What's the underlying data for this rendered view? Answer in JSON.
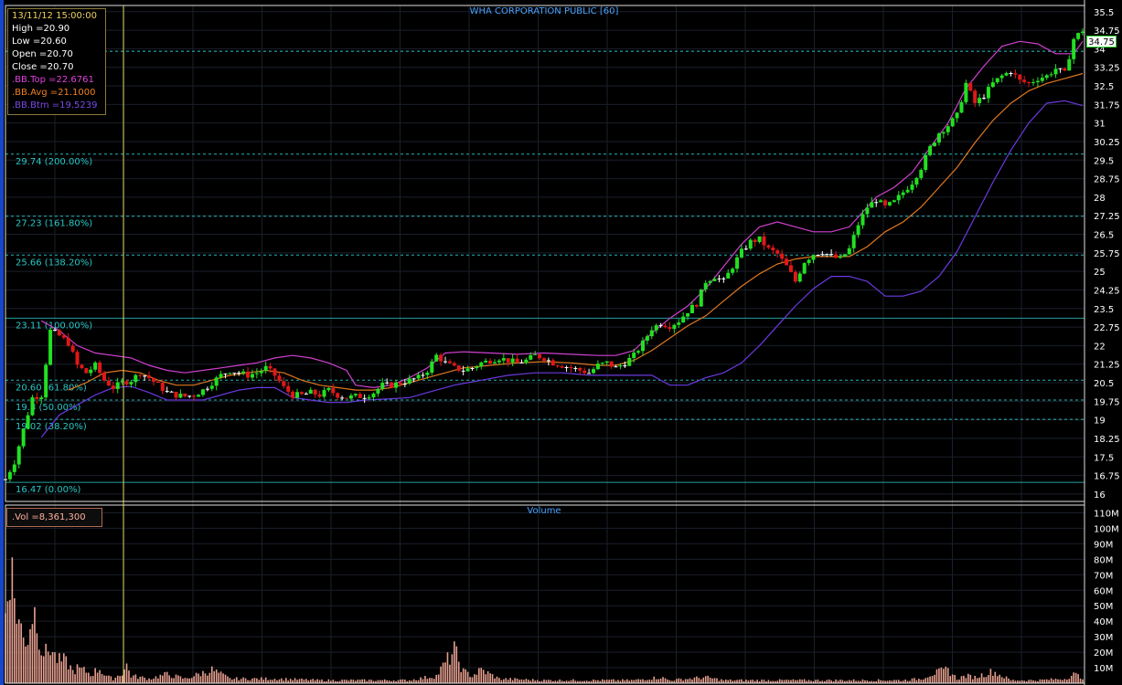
{
  "chart_data": {
    "type": "candlestick",
    "title": "WHA CORPORATION PUBLIC [60]",
    "volume_title": "Volume",
    "info": {
      "datetime": "13/11/12 15:00:00",
      "high": "High  =20.90",
      "low": "Low   =20.60",
      "open": "Open  =20.70",
      "close": "Close =20.70",
      "bb_top": ".BB.Top   =22.6761",
      "bb_avg": ".BB.Avg   =21.1000",
      "bb_btm": ".BB.Btm   =19.5239"
    },
    "volume_label": ".Vol   =8,361,300",
    "last_price": "34.75",
    "price_axis": {
      "ymin": 15.7,
      "ymax": 35.75,
      "ticks": [
        "35.5",
        "34.75",
        "34",
        "33.25",
        "32.5",
        "31.75",
        "31",
        "30.25",
        "29.5",
        "28.75",
        "28",
        "27.25",
        "26.5",
        "25.75",
        "25",
        "24.25",
        "23.5",
        "22.75",
        "22",
        "21.25",
        "20.5",
        "19.75",
        "19",
        "18.25",
        "17.5",
        "16.75",
        "16"
      ]
    },
    "volume_axis": {
      "ymax": 115000000,
      "ticks": [
        "110M",
        "100M",
        "90M",
        "80M",
        "70M",
        "60M",
        "50M",
        "40M",
        "30M",
        "20M",
        "10M"
      ]
    },
    "fibonacci": [
      {
        "label": "29.74 (200.00%)",
        "value": 29.74
      },
      {
        "label": "27.23 (161.80%)",
        "value": 27.23
      },
      {
        "label": "25.66 (138.20%)",
        "value": 25.66
      },
      {
        "label": "23.11 (100.00%)",
        "value": 23.11
      },
      {
        "label": "20.60 (61.80%)",
        "value": 20.6
      },
      {
        "label": "19.8 (50.00%)",
        "value": 19.8
      },
      {
        "label": "19.02 (38.20%)",
        "value": 19.02
      },
      {
        "label": "16.47 (0.00%)",
        "value": 16.47
      }
    ],
    "reference_line": 33.9,
    "colors": {
      "up": "#22e022",
      "down": "#e01818",
      "bb_top": "#d040d0",
      "bb_avg": "#e07820",
      "bb_btm": "#6a3ae0",
      "fib": "#28c8c8",
      "grid": "#1a1f2a",
      "axis_text": "#ffffff",
      "volume": "#e8a090",
      "cursor": "#d8d060"
    },
    "close_path": [
      [
        0,
        16.6
      ],
      [
        2,
        17.3
      ],
      [
        4,
        18.6
      ],
      [
        6,
        19.9
      ],
      [
        8,
        20.0
      ],
      [
        10,
        22.6
      ],
      [
        12,
        22.4
      ],
      [
        14,
        22.1
      ],
      [
        16,
        21.2
      ],
      [
        18,
        20.9
      ],
      [
        20,
        21.2
      ],
      [
        22,
        20.6
      ],
      [
        24,
        20.3
      ],
      [
        26,
        20.5
      ],
      [
        28,
        20.6
      ],
      [
        30,
        20.9
      ],
      [
        32,
        20.7
      ],
      [
        34,
        20.4
      ],
      [
        36,
        20.1
      ],
      [
        38,
        20.0
      ],
      [
        40,
        19.95
      ],
      [
        42,
        20.0
      ],
      [
        44,
        20.2
      ],
      [
        46,
        20.5
      ],
      [
        48,
        20.8
      ],
      [
        50,
        21.0
      ],
      [
        52,
        20.9
      ],
      [
        54,
        20.8
      ],
      [
        56,
        20.9
      ],
      [
        58,
        21.1
      ],
      [
        60,
        20.8
      ],
      [
        62,
        20.3
      ],
      [
        64,
        20.0
      ],
      [
        66,
        20.0
      ],
      [
        68,
        20.1
      ],
      [
        70,
        20.0
      ],
      [
        72,
        20.2
      ],
      [
        74,
        20.0
      ],
      [
        76,
        19.9
      ],
      [
        78,
        19.95
      ],
      [
        80,
        19.95
      ],
      [
        82,
        20.1
      ],
      [
        84,
        20.4
      ],
      [
        86,
        20.4
      ],
      [
        88,
        20.5
      ],
      [
        90,
        20.6
      ],
      [
        92,
        20.7
      ],
      [
        94,
        21.0
      ],
      [
        96,
        21.6
      ],
      [
        98,
        21.3
      ],
      [
        100,
        21.1
      ],
      [
        102,
        21.0
      ],
      [
        104,
        21.1
      ],
      [
        106,
        21.3
      ],
      [
        108,
        21.4
      ],
      [
        110,
        21.5
      ],
      [
        112,
        21.4
      ],
      [
        114,
        21.3
      ],
      [
        116,
        21.4
      ],
      [
        118,
        21.6
      ],
      [
        120,
        21.5
      ],
      [
        122,
        21.3
      ],
      [
        124,
        21.2
      ],
      [
        126,
        21.1
      ],
      [
        128,
        21.0
      ],
      [
        130,
        20.9
      ],
      [
        132,
        21.2
      ],
      [
        134,
        21.3
      ],
      [
        136,
        21.1
      ],
      [
        138,
        21.3
      ],
      [
        140,
        21.6
      ],
      [
        142,
        22.1
      ],
      [
        144,
        22.7
      ],
      [
        146,
        22.9
      ],
      [
        148,
        22.8
      ],
      [
        150,
        23.0
      ],
      [
        152,
        23.4
      ],
      [
        154,
        23.7
      ],
      [
        156,
        24.6
      ],
      [
        158,
        24.8
      ],
      [
        160,
        24.6
      ],
      [
        162,
        25.2
      ],
      [
        164,
        25.8
      ],
      [
        166,
        26.2
      ],
      [
        168,
        26.3
      ],
      [
        170,
        25.9
      ],
      [
        172,
        25.7
      ],
      [
        174,
        25.2
      ],
      [
        176,
        24.6
      ],
      [
        178,
        25.4
      ],
      [
        180,
        25.7
      ],
      [
        182,
        25.8
      ],
      [
        184,
        25.6
      ],
      [
        186,
        25.5
      ],
      [
        188,
        25.9
      ],
      [
        190,
        26.9
      ],
      [
        192,
        27.6
      ],
      [
        194,
        27.9
      ],
      [
        196,
        27.6
      ],
      [
        198,
        27.8
      ],
      [
        200,
        28.2
      ],
      [
        202,
        28.6
      ],
      [
        204,
        29.2
      ],
      [
        206,
        30.0
      ],
      [
        208,
        30.6
      ],
      [
        210,
        30.9
      ],
      [
        212,
        31.3
      ],
      [
        214,
        32.6
      ],
      [
        216,
        31.8
      ],
      [
        218,
        32.1
      ],
      [
        220,
        32.6
      ],
      [
        222,
        32.9
      ],
      [
        224,
        33.1
      ],
      [
        226,
        32.7
      ],
      [
        228,
        32.6
      ],
      [
        230,
        32.8
      ],
      [
        232,
        32.9
      ],
      [
        234,
        33.2
      ],
      [
        236,
        33.0
      ],
      [
        238,
        34.4
      ],
      [
        240,
        34.75
      ]
    ],
    "bb_top_path": [
      [
        8,
        23.0
      ],
      [
        12,
        22.6
      ],
      [
        16,
        22.0
      ],
      [
        20,
        21.7
      ],
      [
        24,
        21.6
      ],
      [
        28,
        21.5
      ],
      [
        32,
        21.2
      ],
      [
        36,
        21.0
      ],
      [
        40,
        20.9
      ],
      [
        44,
        21.0
      ],
      [
        48,
        21.1
      ],
      [
        52,
        21.2
      ],
      [
        56,
        21.3
      ],
      [
        60,
        21.5
      ],
      [
        64,
        21.6
      ],
      [
        68,
        21.5
      ],
      [
        72,
        21.3
      ],
      [
        76,
        21.0
      ],
      [
        78,
        20.4
      ],
      [
        82,
        20.3
      ],
      [
        86,
        20.4
      ],
      [
        90,
        20.7
      ],
      [
        94,
        21.1
      ],
      [
        98,
        21.7
      ],
      [
        102,
        21.75
      ],
      [
        108,
        21.7
      ],
      [
        114,
        21.65
      ],
      [
        120,
        21.7
      ],
      [
        126,
        21.65
      ],
      [
        132,
        21.6
      ],
      [
        136,
        21.6
      ],
      [
        140,
        21.8
      ],
      [
        144,
        22.5
      ],
      [
        148,
        23.1
      ],
      [
        152,
        23.6
      ],
      [
        156,
        24.3
      ],
      [
        160,
        25.2
      ],
      [
        164,
        26.1
      ],
      [
        168,
        26.8
      ],
      [
        172,
        27.0
      ],
      [
        176,
        26.8
      ],
      [
        180,
        26.6
      ],
      [
        184,
        26.6
      ],
      [
        188,
        26.8
      ],
      [
        190,
        27.2
      ],
      [
        194,
        28.0
      ],
      [
        198,
        28.4
      ],
      [
        202,
        29.0
      ],
      [
        206,
        30.0
      ],
      [
        210,
        31.0
      ],
      [
        214,
        32.4
      ],
      [
        218,
        33.3
      ],
      [
        222,
        34.1
      ],
      [
        226,
        34.3
      ],
      [
        230,
        34.2
      ],
      [
        234,
        33.8
      ],
      [
        238,
        33.8
      ],
      [
        240,
        34.3
      ]
    ],
    "bb_avg_path": [
      [
        14,
        20.2
      ],
      [
        18,
        20.5
      ],
      [
        22,
        20.9
      ],
      [
        26,
        21.0
      ],
      [
        30,
        20.9
      ],
      [
        34,
        20.6
      ],
      [
        38,
        20.4
      ],
      [
        42,
        20.4
      ],
      [
        46,
        20.6
      ],
      [
        50,
        20.8
      ],
      [
        54,
        20.9
      ],
      [
        58,
        21.0
      ],
      [
        62,
        20.9
      ],
      [
        66,
        20.6
      ],
      [
        70,
        20.4
      ],
      [
        74,
        20.3
      ],
      [
        78,
        20.2
      ],
      [
        82,
        20.2
      ],
      [
        86,
        20.3
      ],
      [
        90,
        20.5
      ],
      [
        94,
        20.7
      ],
      [
        98,
        20.9
      ],
      [
        102,
        21.1
      ],
      [
        108,
        21.2
      ],
      [
        114,
        21.3
      ],
      [
        120,
        21.35
      ],
      [
        126,
        21.3
      ],
      [
        132,
        21.2
      ],
      [
        136,
        21.2
      ],
      [
        140,
        21.4
      ],
      [
        144,
        21.8
      ],
      [
        148,
        22.3
      ],
      [
        152,
        22.8
      ],
      [
        156,
        23.2
      ],
      [
        160,
        23.8
      ],
      [
        164,
        24.4
      ],
      [
        168,
        24.9
      ],
      [
        172,
        25.3
      ],
      [
        176,
        25.5
      ],
      [
        180,
        25.6
      ],
      [
        184,
        25.6
      ],
      [
        188,
        25.6
      ],
      [
        192,
        26.0
      ],
      [
        196,
        26.6
      ],
      [
        200,
        27.0
      ],
      [
        204,
        27.6
      ],
      [
        208,
        28.4
      ],
      [
        212,
        29.2
      ],
      [
        216,
        30.2
      ],
      [
        220,
        31.1
      ],
      [
        224,
        31.8
      ],
      [
        228,
        32.3
      ],
      [
        232,
        32.6
      ],
      [
        236,
        32.8
      ],
      [
        240,
        33.0
      ]
    ],
    "bb_btm_path": [
      [
        8,
        18.3
      ],
      [
        12,
        19.2
      ],
      [
        16,
        19.6
      ],
      [
        20,
        20.0
      ],
      [
        24,
        20.3
      ],
      [
        28,
        20.35
      ],
      [
        32,
        20.1
      ],
      [
        36,
        19.8
      ],
      [
        40,
        19.8
      ],
      [
        44,
        19.8
      ],
      [
        48,
        20.0
      ],
      [
        52,
        20.2
      ],
      [
        56,
        20.3
      ],
      [
        60,
        20.3
      ],
      [
        64,
        19.9
      ],
      [
        68,
        19.8
      ],
      [
        72,
        19.7
      ],
      [
        76,
        19.7
      ],
      [
        80,
        19.8
      ],
      [
        86,
        19.85
      ],
      [
        90,
        19.9
      ],
      [
        94,
        20.1
      ],
      [
        100,
        20.4
      ],
      [
        106,
        20.6
      ],
      [
        112,
        20.8
      ],
      [
        118,
        20.9
      ],
      [
        124,
        20.9
      ],
      [
        130,
        20.8
      ],
      [
        136,
        20.8
      ],
      [
        140,
        20.8
      ],
      [
        144,
        20.8
      ],
      [
        148,
        20.4
      ],
      [
        152,
        20.4
      ],
      [
        156,
        20.7
      ],
      [
        160,
        20.9
      ],
      [
        164,
        21.3
      ],
      [
        168,
        22.0
      ],
      [
        172,
        22.8
      ],
      [
        176,
        23.6
      ],
      [
        180,
        24.3
      ],
      [
        184,
        24.8
      ],
      [
        188,
        24.8
      ],
      [
        192,
        24.6
      ],
      [
        196,
        24.0
      ],
      [
        200,
        24.0
      ],
      [
        204,
        24.2
      ],
      [
        208,
        24.8
      ],
      [
        212,
        25.8
      ],
      [
        216,
        27.2
      ],
      [
        220,
        28.6
      ],
      [
        224,
        29.9
      ],
      [
        228,
        31.0
      ],
      [
        232,
        31.8
      ],
      [
        236,
        31.9
      ],
      [
        240,
        31.7
      ]
    ],
    "volume_path": [
      [
        0,
        48
      ],
      [
        1,
        85
      ],
      [
        2,
        58
      ],
      [
        3,
        42
      ],
      [
        4,
        30
      ],
      [
        5,
        32
      ],
      [
        6,
        49
      ],
      [
        7,
        46
      ],
      [
        8,
        24
      ],
      [
        9,
        20
      ],
      [
        10,
        25
      ],
      [
        11,
        18
      ],
      [
        12,
        15
      ],
      [
        13,
        15
      ],
      [
        14,
        13
      ],
      [
        15,
        8
      ],
      [
        16,
        10
      ],
      [
        17,
        9
      ],
      [
        18,
        8
      ],
      [
        19,
        6
      ],
      [
        20,
        8
      ],
      [
        21,
        10
      ],
      [
        22,
        6
      ],
      [
        23,
        4
      ],
      [
        24,
        3
      ],
      [
        26,
        7
      ],
      [
        27,
        12
      ],
      [
        28,
        5
      ],
      [
        30,
        4
      ],
      [
        32,
        3
      ],
      [
        36,
        6
      ],
      [
        40,
        3
      ],
      [
        46,
        9
      ],
      [
        50,
        3
      ],
      [
        60,
        3
      ],
      [
        70,
        2
      ],
      [
        80,
        2
      ],
      [
        90,
        2
      ],
      [
        96,
        5
      ],
      [
        100,
        22
      ],
      [
        102,
        8
      ],
      [
        104,
        5
      ],
      [
        106,
        9
      ],
      [
        110,
        3
      ],
      [
        120,
        2
      ],
      [
        130,
        2
      ],
      [
        140,
        2
      ],
      [
        146,
        4
      ],
      [
        148,
        2
      ],
      [
        156,
        4
      ],
      [
        160,
        2
      ],
      [
        170,
        2
      ],
      [
        180,
        2
      ],
      [
        190,
        2
      ],
      [
        200,
        2
      ],
      [
        204,
        3
      ],
      [
        206,
        6
      ],
      [
        210,
        9
      ],
      [
        212,
        3
      ],
      [
        214,
        5
      ],
      [
        216,
        4
      ],
      [
        220,
        8
      ],
      [
        224,
        2
      ],
      [
        230,
        2
      ],
      [
        236,
        3
      ],
      [
        238,
        6
      ],
      [
        240,
        4
      ]
    ]
  }
}
